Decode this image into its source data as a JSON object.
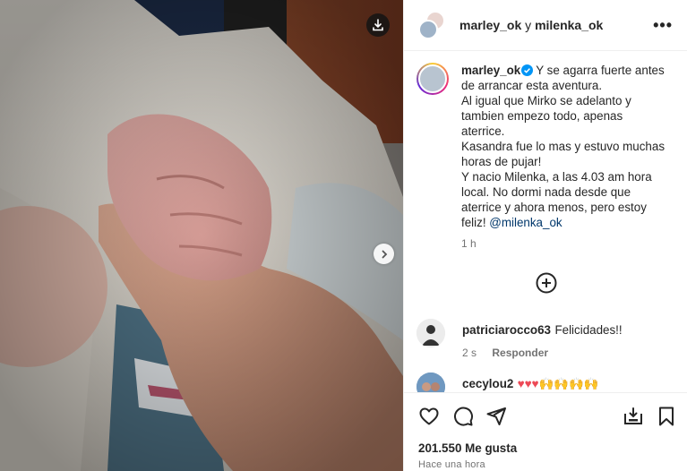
{
  "header": {
    "user1": "marley_ok",
    "conj": "y",
    "user2": "milenka_ok",
    "more": "•••"
  },
  "caption": {
    "username": "marley_ok",
    "lines": [
      "Y se agarra fuerte antes",
      "de arrancar esta aventura.",
      "Al igual que Mirko se adelanto y",
      "tambien empezo todo, apenas",
      "aterrice.",
      "Kasandra fue lo mas y estuvo muchas",
      "horas de pujar!",
      "Y nacio Milenka, a las 4.03 am hora",
      "local. No dormi nada desde que",
      "aterrice y ahora menos, pero estoy"
    ],
    "last_line_prefix": "feliz! ",
    "mention": "@milenka_ok",
    "time": "1 h"
  },
  "comments": [
    {
      "username": "patriciarocco63",
      "text": "Felicidades!!",
      "time": "2 s",
      "reply": "Responder"
    },
    {
      "username": "cecylou2",
      "text": "❤️❤️❤️🙌🙌🙌🙌",
      "hearts": "♥♥♥",
      "hands": "🙌🙌🙌🙌"
    }
  ],
  "footer": {
    "likes": "201.550 Me gusta",
    "posted": "Hace una hora"
  },
  "icons": {
    "download": "download-icon",
    "next": "chevron-right-icon",
    "like": "heart-icon",
    "comment": "comment-icon",
    "share": "send-icon",
    "save_to_collection": "save-to-collection-icon",
    "bookmark": "bookmark-icon",
    "load_more": "plus-circle-icon"
  },
  "colors": {
    "verified": "#0095f6",
    "heart": "#ed4956",
    "mention": "#00376b",
    "muted": "#737373"
  }
}
